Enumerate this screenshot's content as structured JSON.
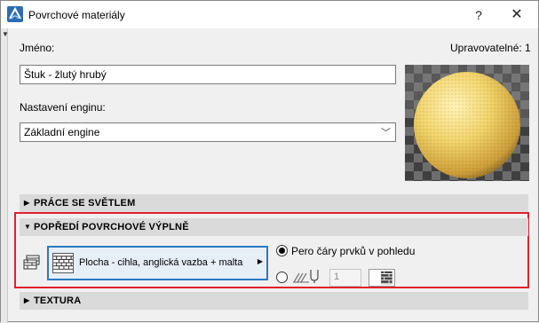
{
  "window": {
    "title": "Povrchové materiály",
    "help_label": "?",
    "close_label": "✕"
  },
  "form": {
    "name_label": "Jméno:",
    "editable_label": "Upravovatelné: 1",
    "name_value": "Štuk - žlutý hrubý",
    "engine_label": "Nastavení enginu:",
    "engine_value": "Základní engine"
  },
  "preview": {
    "sphere_color": "#f0d36a"
  },
  "sections": {
    "light": {
      "label": "PRÁCE SE SVĚTLEM",
      "expanded": false
    },
    "fill": {
      "label": "POPŘEDÍ POVRCHOVÉ VÝPLNĚ",
      "expanded": true
    },
    "texture": {
      "label": "TEXTURA",
      "expanded": false
    }
  },
  "fill": {
    "fill_name": "Plocha - cihla, anglická vazba + malta",
    "pen_option_label": "Pero čáry prvků v pohledu",
    "pen_number": "1",
    "selected_option": "pen_of_element"
  },
  "colors": {
    "highlight": "#e0202a",
    "accent": "#2a7bc0"
  },
  "icons": {
    "app": "archicad-icon",
    "fill_type": "fill-type-icon",
    "pattern": "hatch-pattern-icon",
    "pen": "pen-icon"
  }
}
